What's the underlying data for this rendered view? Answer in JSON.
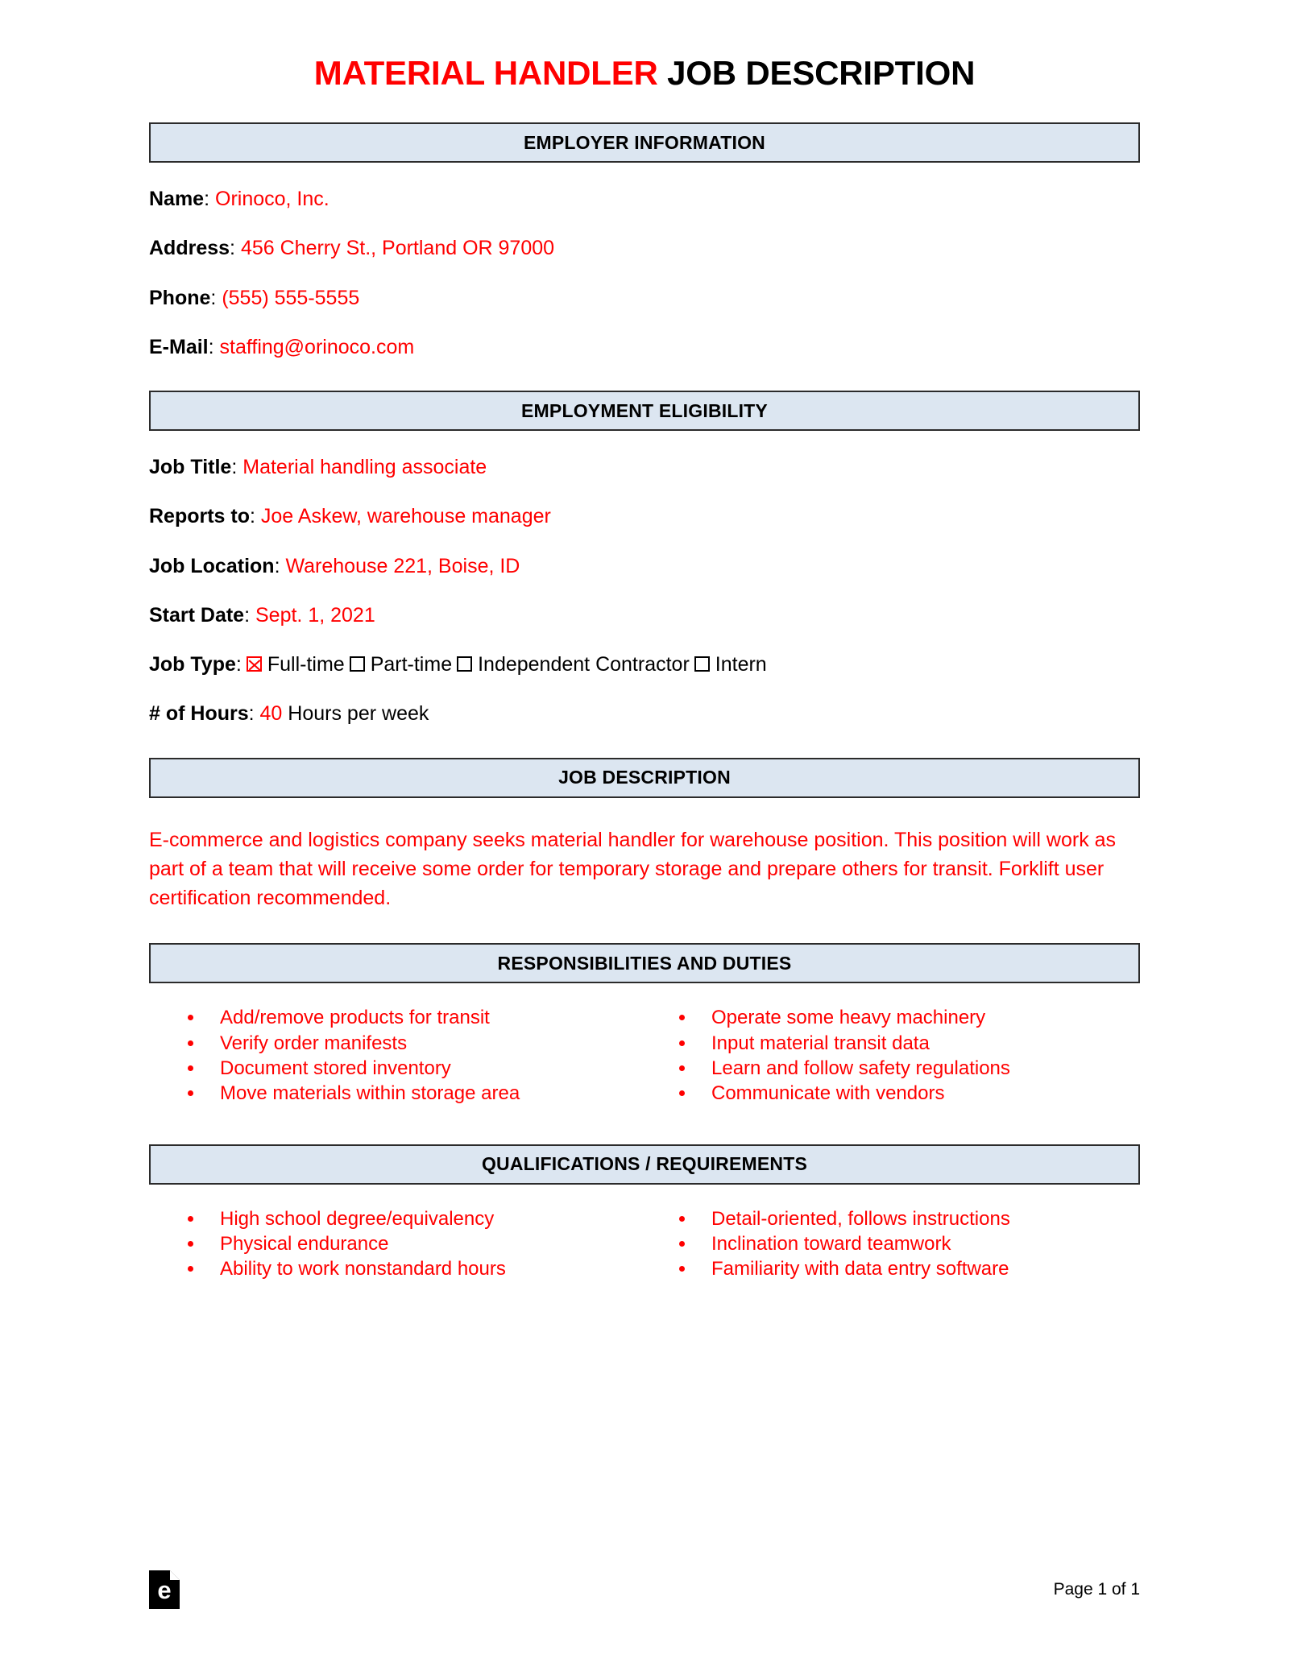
{
  "title": {
    "accent": "MATERIAL HANDLER",
    "rest": " JOB DESCRIPTION"
  },
  "sections": {
    "employer": "EMPLOYER INFORMATION",
    "eligibility": "EMPLOYMENT ELIGIBILITY",
    "description": "JOB DESCRIPTION",
    "responsibilities": "RESPONSIBILITIES AND DUTIES",
    "qualifications": "QUALIFICATIONS / REQUIREMENTS"
  },
  "employer": {
    "name_label": "Name",
    "name_value": "Orinoco, Inc.",
    "address_label": "Address",
    "address_value": "456 Cherry St., Portland OR 97000",
    "phone_label": "Phone",
    "phone_value": "(555) 555-5555",
    "email_label": "E-Mail",
    "email_value": "staffing@orinoco.com"
  },
  "eligibility": {
    "job_title_label": "Job Title",
    "job_title_value": "Material handling associate",
    "reports_to_label": "Reports to",
    "reports_to_value": "Joe Askew, warehouse manager",
    "job_location_label": "Job Location",
    "job_location_value": "Warehouse 221, Boise, ID",
    "start_date_label": "Start Date",
    "start_date_value": "Sept. 1, 2021",
    "job_type_label": "Job Type",
    "job_type_options": [
      {
        "label": "Full-time",
        "checked": true
      },
      {
        "label": "Part-time",
        "checked": false
      },
      {
        "label": "Independent Contractor",
        "checked": false
      },
      {
        "label": "Intern",
        "checked": false
      }
    ],
    "hours_label": "# of Hours",
    "hours_value": "40",
    "hours_suffix": "Hours per week"
  },
  "description": {
    "text": "E-commerce and logistics company seeks material handler for warehouse position. This position will work as part of a team that will receive some order for temporary storage and prepare others for transit. Forklift user certification recommended."
  },
  "responsibilities": {
    "left": [
      "Add/remove products for transit",
      "Verify order manifests",
      "Document stored inventory",
      "Move materials within storage area"
    ],
    "right": [
      "Operate some heavy machinery",
      "Input material transit data",
      "Learn and follow safety regulations",
      "Communicate with vendors"
    ]
  },
  "qualifications": {
    "left": [
      "High school degree/equivalency",
      "Physical endurance",
      "Ability to work nonstandard hours"
    ],
    "right": [
      "Detail-oriented, follows instructions",
      "Inclination toward teamwork",
      "Familiarity with data entry software"
    ]
  },
  "footer": {
    "logo_letter": "e",
    "page_number": "Page 1 of 1"
  },
  "colors": {
    "accent_red": "#ff0000",
    "section_fill": "#dce6f1",
    "section_border": "#2b2b2b"
  }
}
